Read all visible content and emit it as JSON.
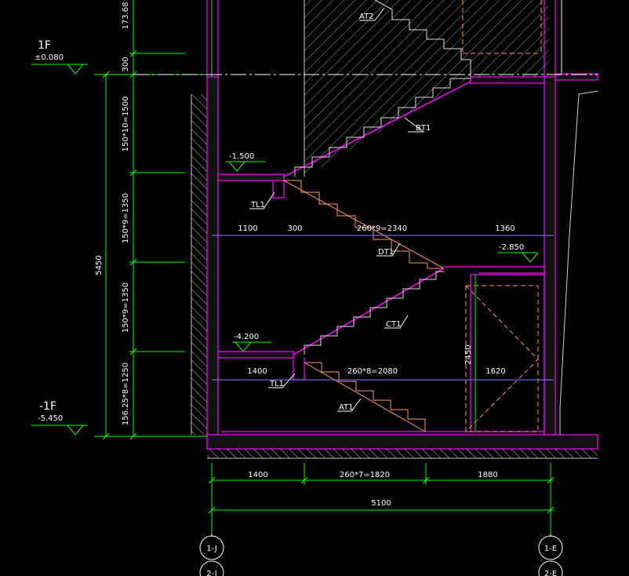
{
  "levels": {
    "floor1_name": "1F",
    "floor1_elev": "±0.080",
    "basement_name": "-1F",
    "basement_elev": "-5.450",
    "landing_upper": "-1.500",
    "landing_middle": "-2.850",
    "landing_lower": "-4.200"
  },
  "vertical_dims": {
    "total": "5450",
    "seg_top": "173.68",
    "seg_300": "300",
    "seg_1": "150*10=1500",
    "seg_2": "150*9=1350",
    "seg_3": "150*9=1350",
    "seg_4": "156.25*8=1250",
    "inner": "2450"
  },
  "horizontal_dims": {
    "upper_1": "1100",
    "upper_2": "300",
    "upper_3": "260*9=2340",
    "upper_4": "1360",
    "lower_1": "1400",
    "lower_2": "260*8=2080",
    "lower_3": "1620",
    "bottom_1": "1400",
    "bottom_2": "260*7=1820",
    "bottom_3": "1880",
    "bottom_total": "5100"
  },
  "stair_labels": {
    "at2": "AT2",
    "bt1": "BT1",
    "dt1": "DT1",
    "ct1": "CT1",
    "at1": "AT1",
    "tl1_upper": "TL1",
    "tl1_lower": "TL1"
  },
  "axes": {
    "left_1": "1-J",
    "left_2": "2-J",
    "right_1": "1-E",
    "right_2": "2-E"
  },
  "colors": {
    "background": "#000000",
    "wall": "#ff00ff",
    "dimension": "#00ff00",
    "stair": "#ff9966",
    "text": "#ffffff",
    "hatch": "#b0b0b0",
    "axis_circle": "#ffffff",
    "grid_blue": "#8080ff"
  }
}
